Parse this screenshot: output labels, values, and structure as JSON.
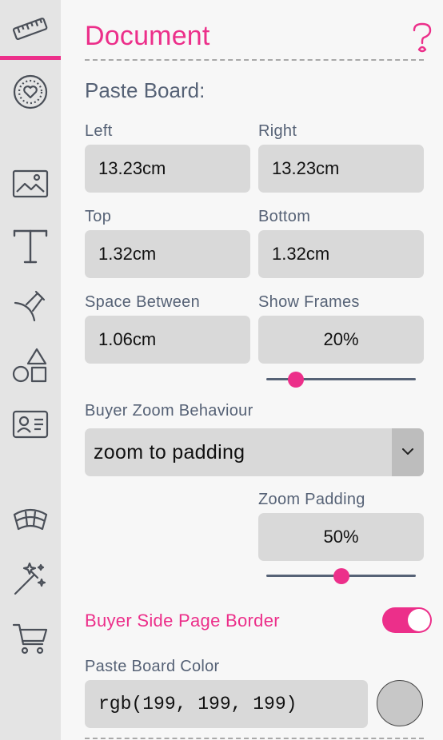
{
  "header": {
    "title": "Document"
  },
  "sidebar": {
    "items": [
      {
        "icon": "ruler-icon",
        "active": true
      },
      {
        "icon": "heart-badge-icon"
      },
      {
        "icon": "image-icon"
      },
      {
        "icon": "text-icon"
      },
      {
        "icon": "pen-nib-icon"
      },
      {
        "icon": "shapes-icon"
      },
      {
        "icon": "id-card-icon"
      },
      {
        "icon": "curved-panel-icon"
      },
      {
        "icon": "magic-wand-icon"
      },
      {
        "icon": "cart-icon"
      }
    ]
  },
  "paste_board": {
    "section_title": "Paste Board:",
    "left_label": "Left",
    "left_value": "13.23cm",
    "right_label": "Right",
    "right_value": "13.23cm",
    "top_label": "Top",
    "top_value": "1.32cm",
    "bottom_label": "Bottom",
    "bottom_value": "1.32cm",
    "space_between_label": "Space Between",
    "space_between_value": "1.06cm",
    "show_frames_label": "Show Frames",
    "show_frames_value": "20%",
    "show_frames_slider": 0.2
  },
  "zoom": {
    "behaviour_label": "Buyer Zoom Behaviour",
    "behaviour_value": "zoom to padding",
    "padding_label": "Zoom Padding",
    "padding_value": "50%",
    "padding_slider": 0.5
  },
  "page_border": {
    "label": "Buyer Side Page Border",
    "enabled": true
  },
  "color": {
    "label": "Paste Board Color",
    "value": "rgb(199, 199, 199)",
    "swatch": "#c7c7c7"
  },
  "colors": {
    "accent": "#ec2f8a",
    "label": "#566276",
    "field": "#d9d9d9",
    "sidebar": "#e4e4e4"
  }
}
